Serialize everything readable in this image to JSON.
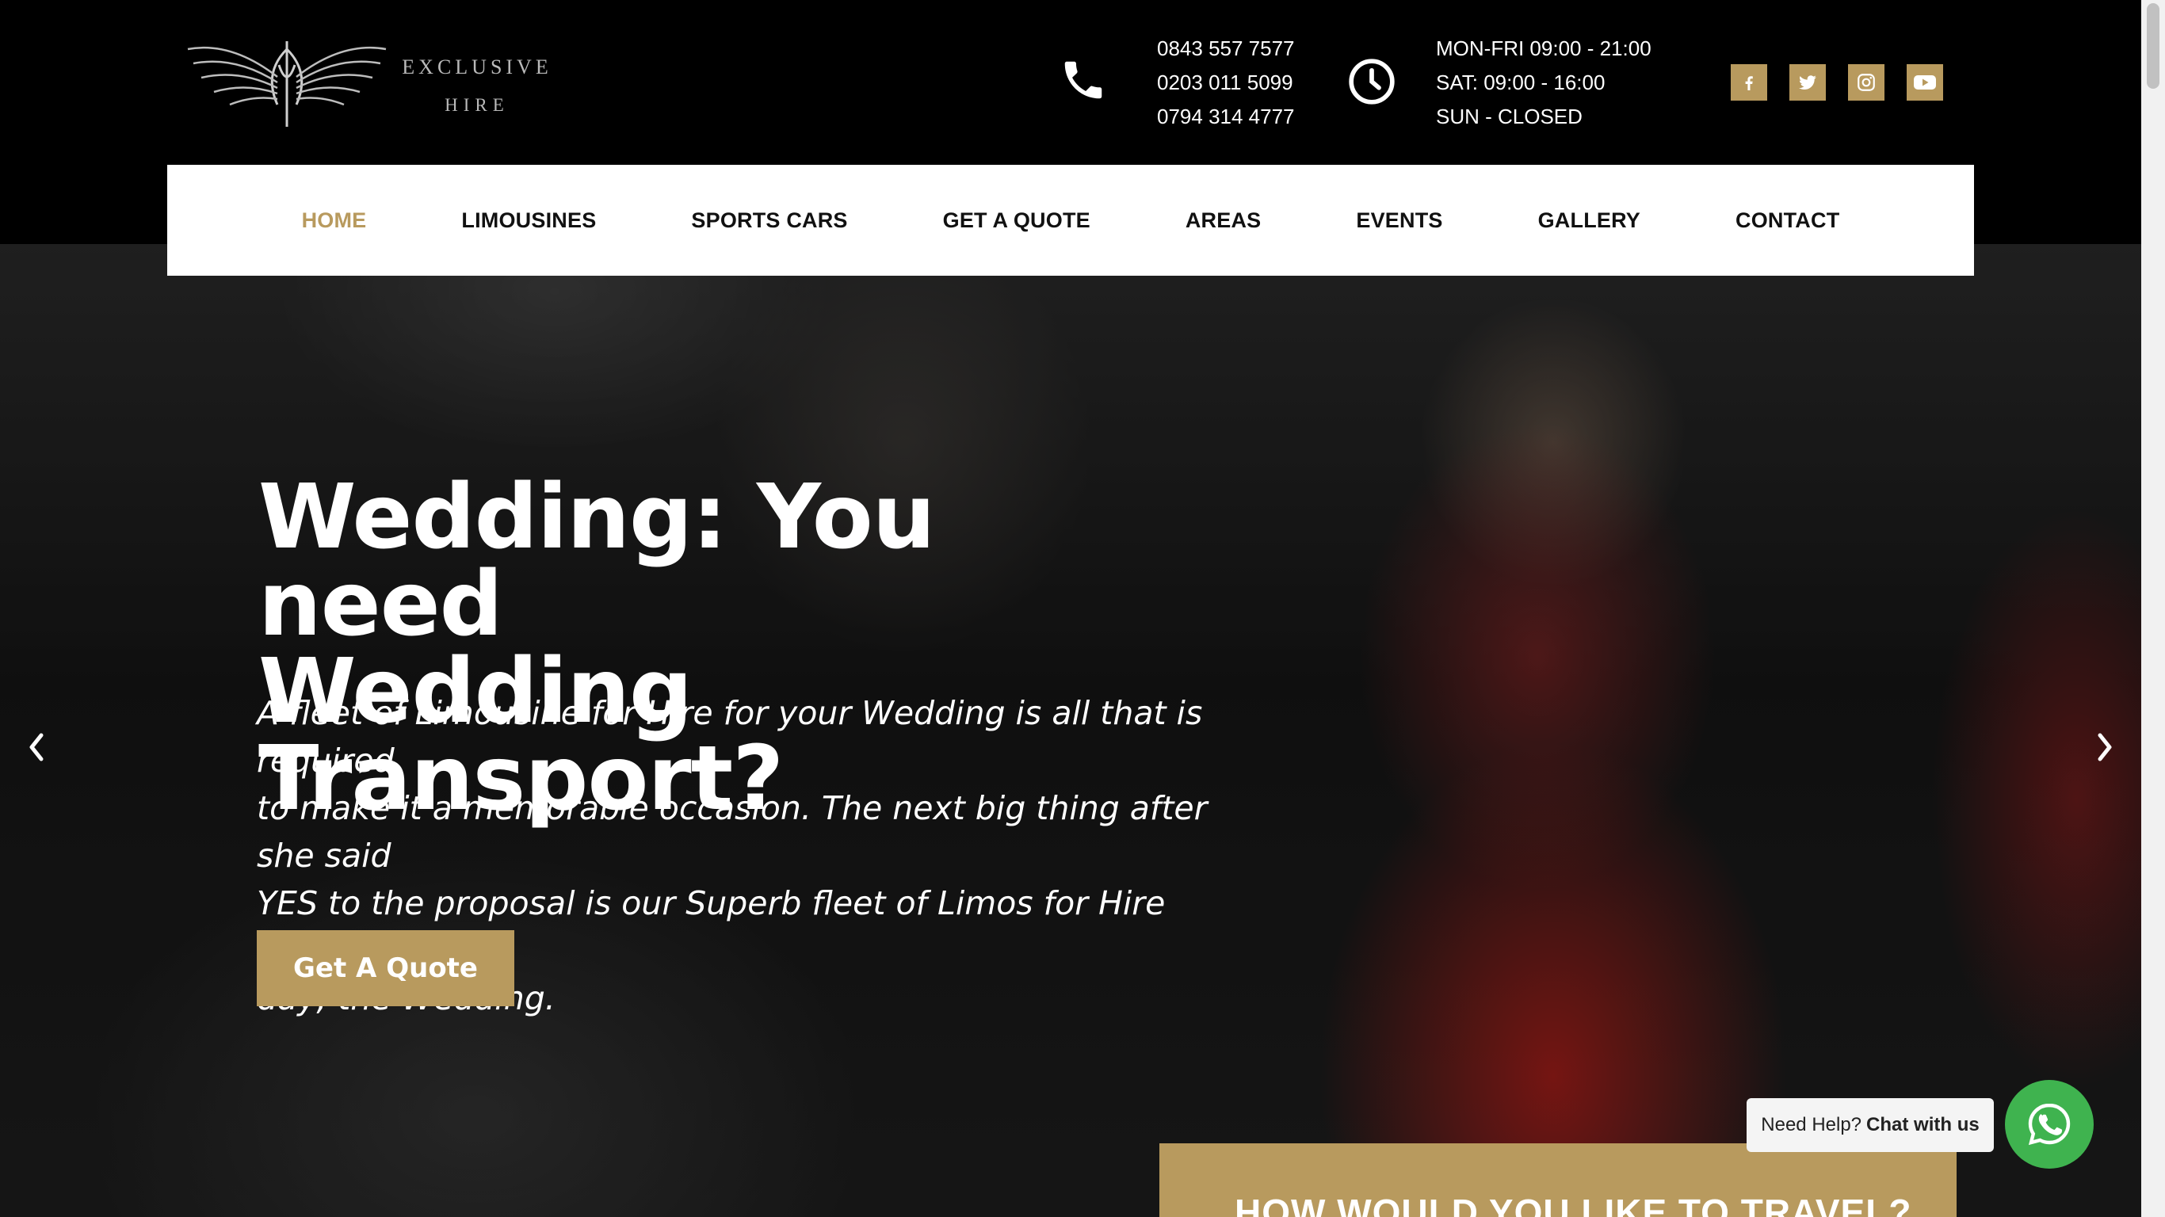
{
  "brand": {
    "line1": "EXCLUSIVE",
    "line2": "HIRE"
  },
  "contact": {
    "phones": [
      "0843 557 7577",
      "0203 011 5099",
      "0794 314 4777"
    ],
    "hours": [
      "MON-FRI 09:00 - 21:00",
      "SAT: 09:00 - 16:00",
      "SUN - CLOSED"
    ]
  },
  "socials": [
    "facebook-icon",
    "twitter-icon",
    "instagram-icon",
    "youtube-icon"
  ],
  "nav": {
    "items": [
      {
        "label": "HOME",
        "active": true
      },
      {
        "label": "LIMOUSINES"
      },
      {
        "label": "SPORTS CARS"
      },
      {
        "label": "GET A QUOTE"
      },
      {
        "label": "AREAS"
      },
      {
        "label": "EVENTS"
      },
      {
        "label": "GALLERY"
      },
      {
        "label": "CONTACT"
      }
    ]
  },
  "hero": {
    "title_line1": "Wedding: You need",
    "title_line2": "Wedding Transport?",
    "text_lines": [
      "A fleet of Limousine for Hire for your Wedding is all that is required",
      "to make it a memorable occasion. The next big thing after she said",
      "YES to the proposal is our Superb fleet of Limos for Hire for her big",
      "day; the Wedding."
    ],
    "button": "Get A Quote"
  },
  "travel_heading": "HOW WOULD YOU LIKE TO TRAVEL?",
  "chat": {
    "prompt": "Need Help?",
    "action": "Chat with us"
  },
  "colors": {
    "accent": "#b89a5e",
    "whatsapp": "#3fb34f",
    "header_bg": "#000000"
  }
}
